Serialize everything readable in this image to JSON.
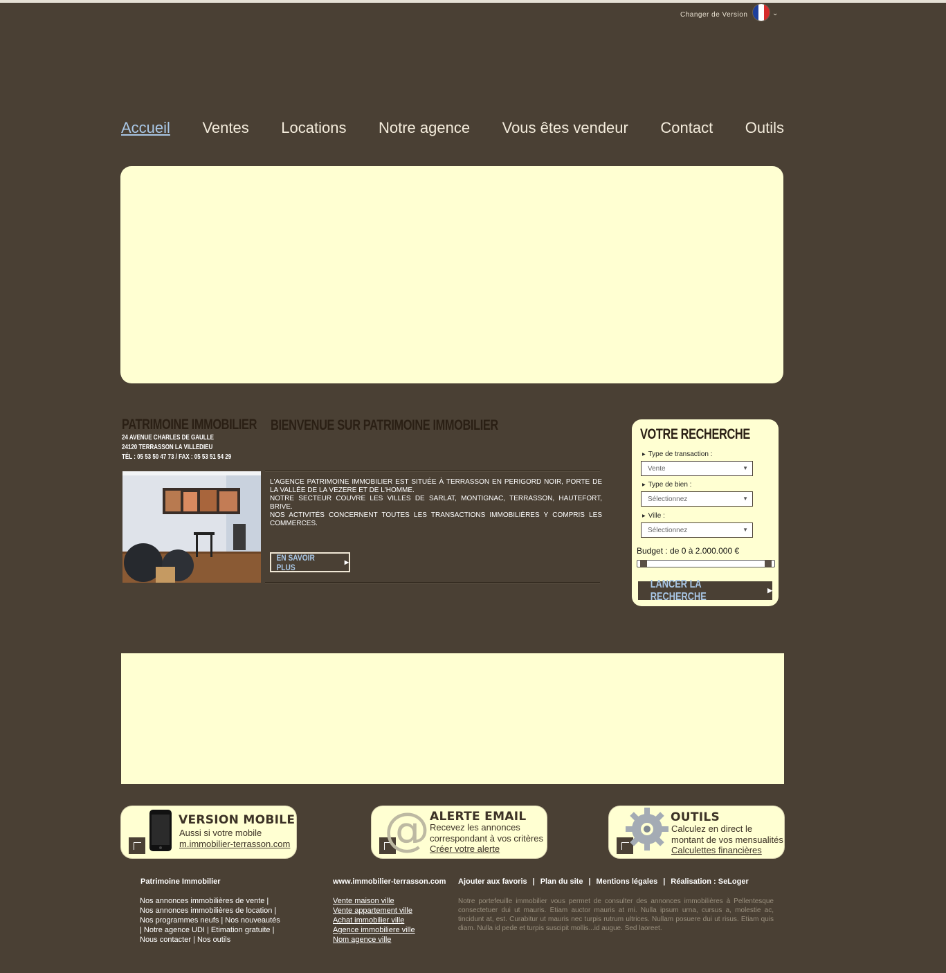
{
  "header": {
    "version_label": "Changer de Version",
    "flag_colors": [
      "#1d3f9c",
      "#ffffff",
      "#d62b2b"
    ]
  },
  "nav": {
    "items": [
      "Accueil",
      "Ventes",
      "Locations",
      "Notre agence",
      "Vous êtes vendeur",
      "Contact",
      "Outils"
    ],
    "active_color": "#a9c7e6"
  },
  "agency": {
    "name": "PATRIMOINE IMMOBILIER",
    "address_line1": "24 AVENUE CHARLES DE GAULLE",
    "address_line2": "24120 TERRASSON LA VILLEDIEU",
    "phone_line": "TÉL : 05 53 50 47 73 / FAX : 05 53 51 54 29"
  },
  "welcome": {
    "title": "BIENVENUE SUR PATRIMOINE IMMOBILIER",
    "paragraphs": [
      "L'AGENCE PATRIMOINE IMMOBILIER EST SITUÉE À TERRASSON EN PERIGORD NOIR, PORTE DE LA VALLÉE DE LA VEZERE ET DE L'HOMME.",
      "NOTRE SECTEUR COUVRE LES VILLES DE SARLAT, MONTIGNAC, TERRASSON, HAUTEFORT, BRIVE.",
      "NOS ACTIVITÉS CONCERNENT TOUTES LES TRANSACTIONS IMMOBILIÈRES Y COMPRIS LES COMMERCES."
    ],
    "more_label": "EN SAVOIR PLUS"
  },
  "search": {
    "title": "VOTRE RECHERCHE",
    "transaction_label": "Type de transaction :",
    "transaction_value": "Vente",
    "property_label": "Type de bien :",
    "property_value": "Sélectionnez",
    "city_label": "Ville :",
    "city_value": "Sélectionnez",
    "budget_label": "Budget : de 0 à 2.000.000 €",
    "budget_min_fraction": 0,
    "budget_max_fraction": 1,
    "launch_label": "LANCER LA RECHERCHE"
  },
  "promos": {
    "mobile": {
      "title": "VERSION MOBILE",
      "line1": "Aussi si votre mobile",
      "link": "m.immobilier-terrasson.com"
    },
    "email": {
      "title": "ALERTE EMAIL",
      "line1": "Recevez les annonces",
      "line2": "correspondant à vos critères",
      "link": "Créer votre alerte"
    },
    "tools": {
      "title": "OUTILS",
      "line1": "Calculez en direct le",
      "line2": "montant de vos mensualités",
      "link": "Calculettes financières"
    }
  },
  "footer": {
    "col1_title": "Patrimoine Immobilier",
    "col1_lines": [
      "Nos annonces immobilières de vente |",
      "Nos annonces immobilières de location |",
      "Nos programmes neufs | Nos nouveautés",
      "| Notre agence UDI | Etimation gratuite |",
      "Nous contacter | Nos outils"
    ],
    "col2_title": "www.immobilier-terrasson.com",
    "col2_links": [
      "Vente maison ville",
      "Vente appartement ville",
      "Achat immobilier ville",
      "Agence immobiliere ville",
      "Nom agence ville"
    ],
    "bar_links": [
      "Ajouter aux favoris",
      "Plan du site",
      "Mentions légales",
      "Réalisation : SeLoger"
    ],
    "description": "Notre portefeuille immobilier vous permet de consulter des annonces immobilières à Pellentesque consectetuer dui ut mauris. Etiam auctor mauris at mi. Nulla ipsum urna, cursus a, molestie ac, tincidunt at, est. Curabitur ut mauris nec turpis rutrum ultrices. Nullam posuere dui ut risus. Etiam quis diam. Nulla id pede et turpis suscipit mollis...id augue. Sed laoreet."
  }
}
